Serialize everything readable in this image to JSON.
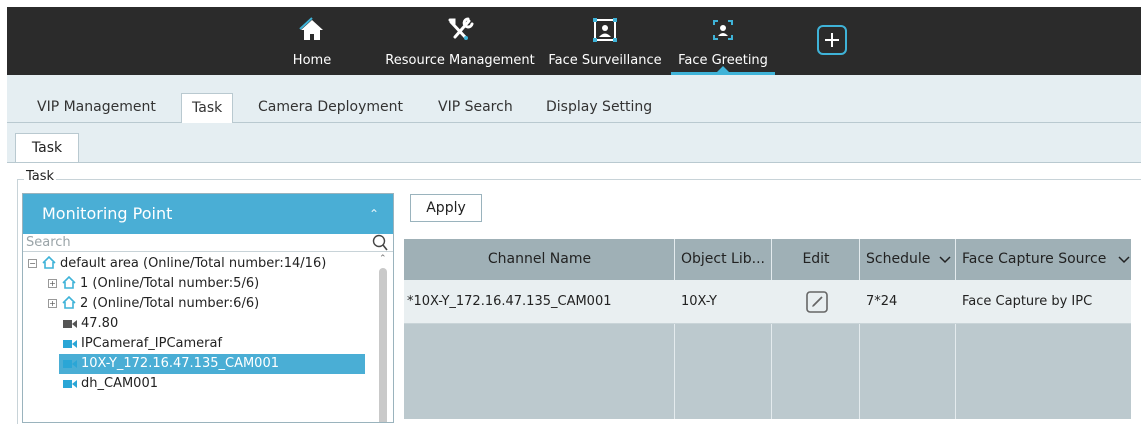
{
  "nav": {
    "items": [
      {
        "label": "Home",
        "icon": "home-icon"
      },
      {
        "label": "Resource Management",
        "icon": "tools-icon"
      },
      {
        "label": "Face Surveillance",
        "icon": "face-frame-icon"
      },
      {
        "label": "Face Greeting",
        "icon": "face-greeting-icon",
        "active": true
      }
    ],
    "add_icon": "plus-icon",
    "accent": "#3fb3d8"
  },
  "tabs": [
    "VIP Management",
    "Task",
    "Camera Deployment",
    "VIP Search",
    "Display Setting"
  ],
  "active_tab": "Task",
  "subtab": "Task",
  "group_title": "Task",
  "monitoring": {
    "title": "Monitoring Point",
    "search_placeholder": "Search",
    "tree": [
      "default area (Online/Total number:14/16)",
      "1 (Online/Total number:5/6)",
      "2 (Online/Total number:6/6)",
      "47.80",
      "IPCameraf_IPCameraf",
      "10X-Y_172.16.47.135_CAM001",
      "dh_CAM001"
    ],
    "selected": "10X-Y_172.16.47.135_CAM001"
  },
  "apply_label": "Apply",
  "table": {
    "headers": [
      "Channel Name",
      "Object Lib...",
      "Edit",
      "Schedule",
      "Face Capture Source"
    ],
    "rows": [
      {
        "channel": "*10X-Y_172.16.47.135_CAM001",
        "object_lib": "10X-Y",
        "schedule": "7*24",
        "capture_source": "Face Capture by IPC"
      }
    ]
  },
  "colors": {
    "header_blue": "#4aaed5",
    "nav_bg": "#2b2b2b",
    "table_head": "#9fb0b6"
  }
}
